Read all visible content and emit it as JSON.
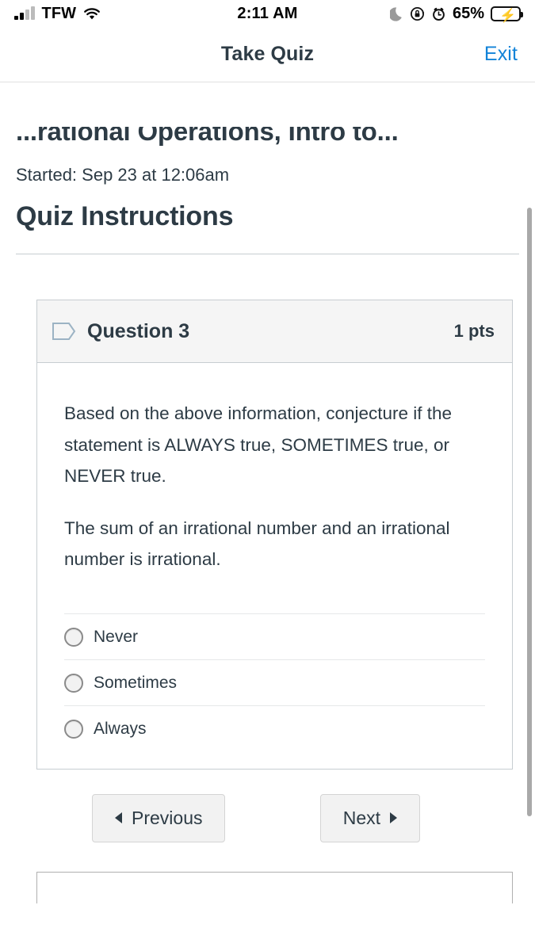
{
  "status_bar": {
    "carrier": "TFW",
    "time": "2:11 AM",
    "battery_percent": "65%",
    "icons": [
      "signal-bars-icon",
      "wifi-icon",
      "moon-dnd-icon",
      "rotation-lock-icon",
      "alarm-clock-icon",
      "battery-charging-icon"
    ]
  },
  "nav_bar": {
    "title": "Take Quiz",
    "exit_label": "Exit"
  },
  "quiz": {
    "clipped_title": "...rational Operations, Intro to...",
    "started_line": "Started: Sep 23 at 12:06am",
    "instructions_heading": "Quiz Instructions"
  },
  "question": {
    "icon": "question-flag-icon",
    "name": "Question 3",
    "points": "1 pts",
    "paragraphs": [
      "Based on the above information, conjecture if the statement is ALWAYS true, SOMETIMES true, or NEVER true.",
      "The sum of an irrational number and an irrational number is irrational."
    ],
    "answers": [
      {
        "label": "Never",
        "selected": false
      },
      {
        "label": "Sometimes",
        "selected": false
      },
      {
        "label": "Always",
        "selected": false
      }
    ]
  },
  "navigation": {
    "previous_label": "Previous",
    "next_label": "Next"
  },
  "colors": {
    "accent_link": "#1283d8",
    "text_primary": "#2d3b45",
    "card_header_bg": "#f5f5f5",
    "battery_fill": "#f9d423"
  }
}
